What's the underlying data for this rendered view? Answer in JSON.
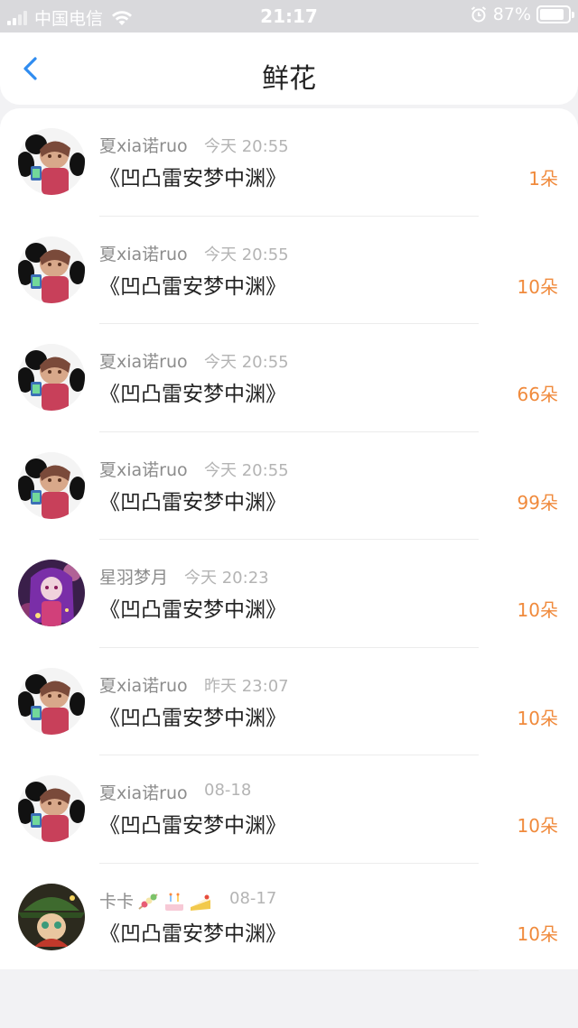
{
  "status_bar": {
    "carrier": "中国电信",
    "time": "21:17",
    "battery": "87%",
    "battery_level": 0.87
  },
  "header": {
    "title": "鲜花",
    "back_icon": "chevron-left-icon"
  },
  "colors": {
    "accent": "#2f8cf0",
    "count": "#f08a3c",
    "name": "#8c8c8c",
    "time": "#b4b4b4"
  },
  "items": [
    {
      "name": "夏xia诺ruo",
      "time": "今天 20:55",
      "book": "《凹凸雷安梦中渊》",
      "count": "1朵",
      "avatar": "panda-avatar"
    },
    {
      "name": "夏xia诺ruo",
      "time": "今天 20:55",
      "book": "《凹凸雷安梦中渊》",
      "count": "10朵",
      "avatar": "panda-avatar"
    },
    {
      "name": "夏xia诺ruo",
      "time": "今天 20:55",
      "book": "《凹凸雷安梦中渊》",
      "count": "66朵",
      "avatar": "panda-avatar"
    },
    {
      "name": "夏xia诺ruo",
      "time": "今天 20:55",
      "book": "《凹凸雷安梦中渊》",
      "count": "99朵",
      "avatar": "panda-avatar"
    },
    {
      "name": "星羽梦月",
      "time": "今天 20:23",
      "book": "《凹凸雷安梦中渊》",
      "count": "10朵",
      "avatar": "purple-girl-avatar"
    },
    {
      "name": "夏xia诺ruo",
      "time": "昨天 23:07",
      "book": "《凹凸雷安梦中渊》",
      "count": "10朵",
      "avatar": "panda-avatar"
    },
    {
      "name": "夏xia诺ruo",
      "time": "08-18",
      "book": "《凹凸雷安梦中渊》",
      "count": "10朵",
      "avatar": "panda-avatar"
    },
    {
      "name": "卡卡",
      "time": "08-17",
      "book": "《凹凸雷安梦中渊》",
      "count": "10朵",
      "avatar": "green-hat-avatar",
      "name_emojis": [
        "skewer-icon",
        "cake-icon",
        "cake-slice-icon"
      ]
    }
  ]
}
